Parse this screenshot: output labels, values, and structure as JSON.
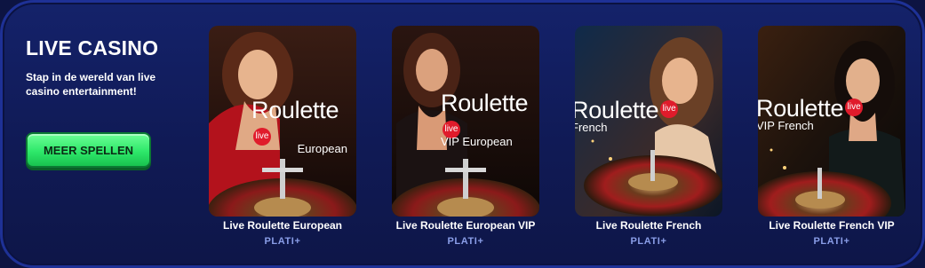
{
  "section": {
    "title": "LIVE CASINO",
    "subtitle": "Stap in de wereld van live casino entertainment!",
    "cta_label": "MEER SPELLEN"
  },
  "games": [
    {
      "name": "Live Roulette European",
      "provider": "PLATI+",
      "logo_word": "Roulette",
      "logo_badge": "live",
      "logo_sub": "European"
    },
    {
      "name": "Live Roulette European VIP",
      "provider": "PLATI+",
      "logo_word": "Roulette",
      "logo_badge": "live",
      "logo_sub": "VIP European"
    },
    {
      "name": "Live Roulette French",
      "provider": "PLATI+",
      "logo_word": "Roulette",
      "logo_badge": "live",
      "logo_sub": "French"
    },
    {
      "name": "Live Roulette French VIP",
      "provider": "PLATI+",
      "logo_word": "Roulette",
      "logo_badge": "live",
      "logo_sub": "VIP French"
    }
  ]
}
